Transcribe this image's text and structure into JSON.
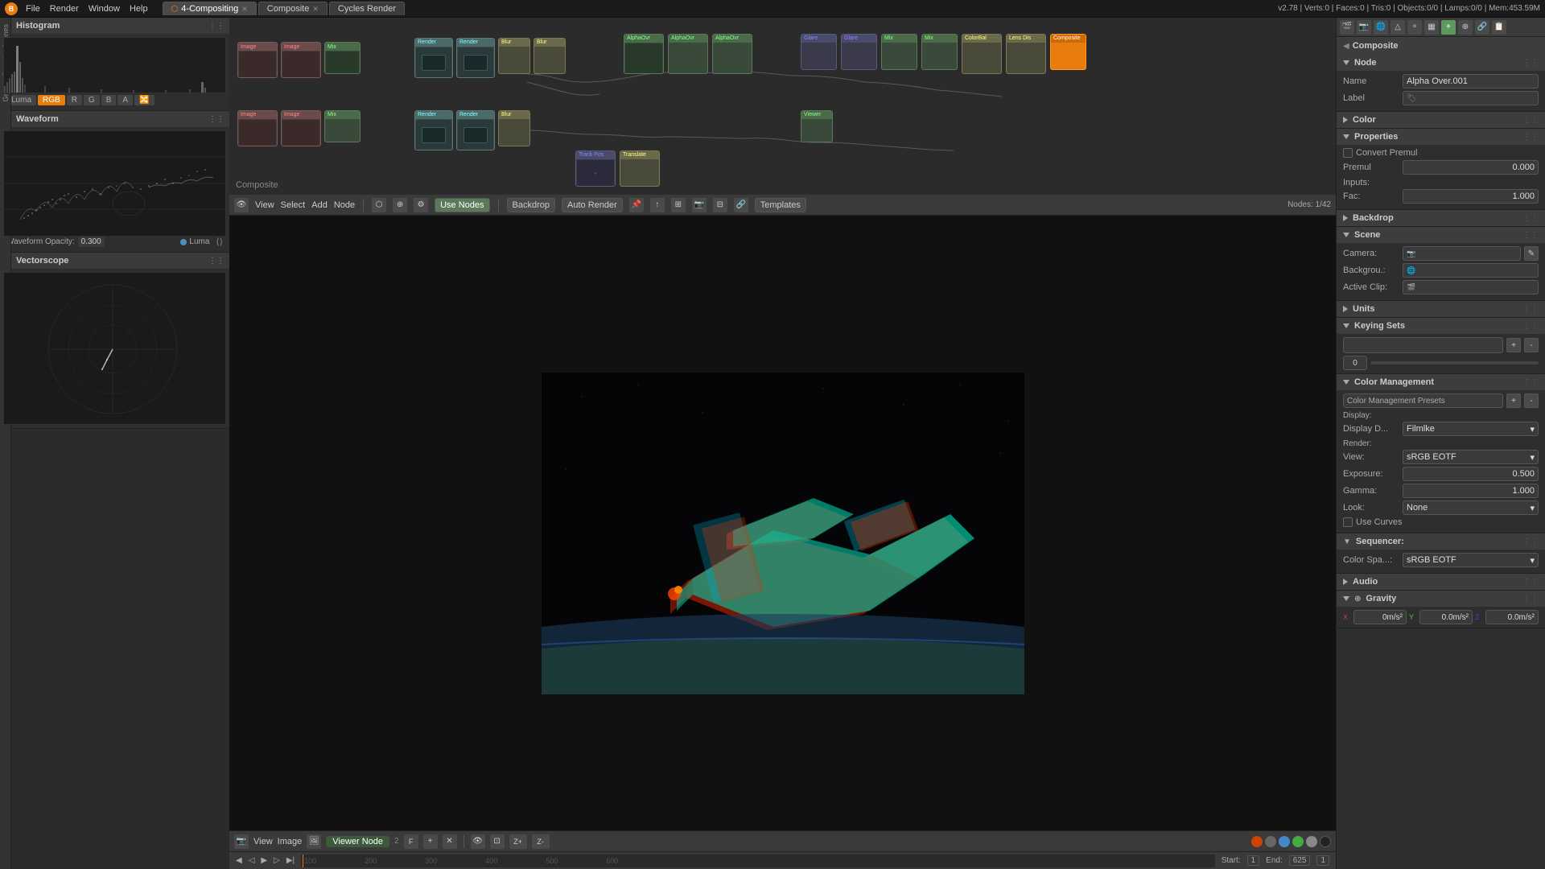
{
  "topbar": {
    "logo": "B",
    "menus": [
      "File",
      "Render",
      "Window",
      "Help"
    ],
    "tabs": [
      {
        "label": "4-Compositing",
        "active": true,
        "icon": "⬡"
      },
      {
        "label": "Composite",
        "active": false
      },
      {
        "label": "Cycles Render",
        "active": false
      }
    ],
    "info": "v2.78 | Verts:0 | Faces:0 | Tris:0 | Objects:0/0 | Lamps:0/0 | Mem:453.59M"
  },
  "toolbar": {
    "view_label": "View",
    "select_label": "Select",
    "add_label": "Add",
    "node_label": "Node",
    "use_nodes_label": "Use Nodes",
    "backdrop_label": "Backdrop",
    "auto_render_label": "Auto Render",
    "templates_label": "Templates",
    "nodes_count": "Nodes: 1/42"
  },
  "left_panel": {
    "histogram": {
      "title": "Histogram",
      "tabs": [
        "Luma",
        "RGB",
        "R",
        "G",
        "B",
        "A"
      ]
    },
    "waveform": {
      "title": "Waveform",
      "opacity_label": "Waveform Opacity:",
      "opacity_value": "0.300",
      "mode_label": "Luma"
    },
    "vectorscope": {
      "title": "Vectorscope"
    }
  },
  "viewer": {
    "label": "Composite",
    "bottom_toolbar": {
      "view_label": "View",
      "image_label": "Image",
      "viewer_node_label": "Viewer Node"
    }
  },
  "right_panel": {
    "node_section": {
      "title": "Node",
      "name_label": "Name",
      "name_value": "Alpha Over.001",
      "label_label": "Label",
      "label_value": ""
    },
    "color_section": {
      "title": "Color"
    },
    "properties_section": {
      "title": "Properties",
      "convert_premul_label": "Convert Premul",
      "premul_label": "Premul",
      "premul_value": "0.000",
      "inputs_label": "Inputs:",
      "fac_label": "Fac:",
      "fac_value": "1.000"
    },
    "backdrop_section": {
      "title": "Backdrop"
    },
    "composite_section": {
      "title": "Composite"
    },
    "scene_section": {
      "title": "Scene",
      "camera_label": "Camera:",
      "background_label": "Backgrou.:",
      "active_clip_label": "Active Clip:"
    },
    "units_section": {
      "title": "Units"
    },
    "keying_sets_section": {
      "title": "Keying Sets",
      "value": "0"
    },
    "color_management_section": {
      "title": "Color Management",
      "presets_label": "Color Management Presets",
      "display_label": "Display:",
      "display_d_label": "Display D...",
      "display_value": "Filmlke",
      "render_label": "Render:",
      "view_label": "View:",
      "view_value": "sRGB EOTF",
      "exposure_label": "Exposure:",
      "exposure_value": "0.500",
      "gamma_label": "Gamma:",
      "gamma_value": "1.000",
      "look_label": "Look:",
      "look_value": "None",
      "use_curves_label": "Use Curves"
    },
    "sequencer_section": {
      "title": "Sequencer:",
      "color_space_label": "Color Spa...:",
      "color_space_value": "sRGB EOTF"
    },
    "audio_section": {
      "title": "Audio"
    },
    "gravity_section": {
      "title": "Gravity",
      "x_label": "X",
      "x_value": "0m/s²",
      "y_label": "Y",
      "y_value": "0.0m/s²",
      "z_label": "Z",
      "z_value": "0.0m/s²"
    }
  },
  "timeline": {
    "frame_start": "1",
    "frame_end": "625",
    "frame_current": "End:",
    "markers": [
      "100",
      "200",
      "300",
      "400",
      "500",
      "600"
    ]
  }
}
